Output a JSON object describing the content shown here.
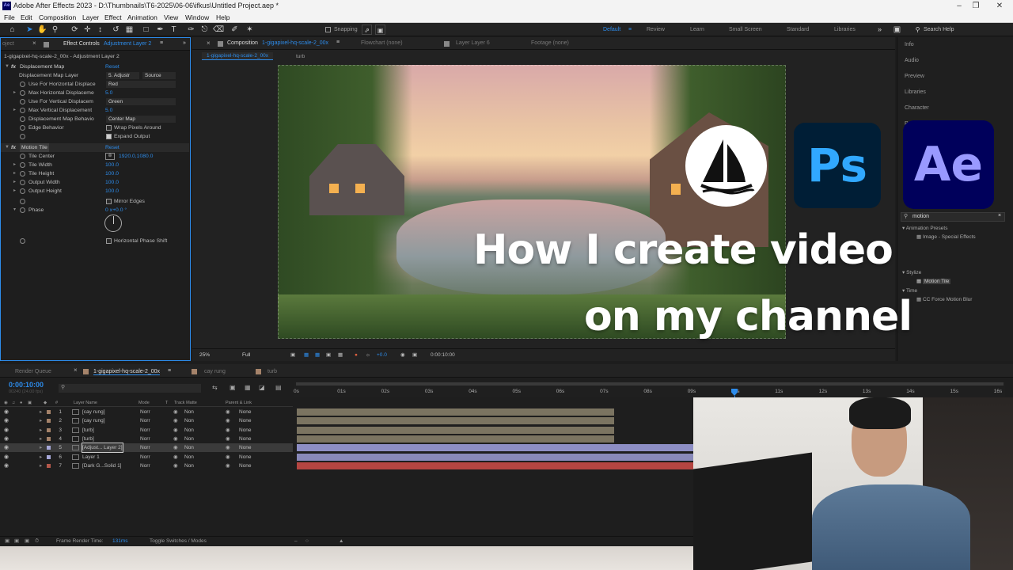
{
  "window": {
    "title": "Adobe After Effects 2023 - D:\\Thumbnails\\T6-2025\\06-06\\ifkus\\Untitled Project.aep *",
    "logo": "Ae"
  },
  "menu": [
    "File",
    "Edit",
    "Composition",
    "Layer",
    "Effect",
    "Animation",
    "View",
    "Window",
    "Help"
  ],
  "toolbar": {
    "snapping": "Snapping",
    "workspaces": [
      "Default",
      "Review",
      "Learn",
      "Small Screen",
      "Standard",
      "Libraries"
    ],
    "active_workspace": "Default",
    "search": "Search Help"
  },
  "effect_controls": {
    "tab_project": "oject",
    "tab": "Effect Controls",
    "tab_layer": "Adjustment Layer 2",
    "breadcrumb": "1-gigapixel-hq-scale-2_00x - Adjustment Layer 2",
    "displacement": {
      "name": "Displacement Map",
      "reset": "Reset",
      "rows": [
        {
          "label": "Displacement Map Layer",
          "value": "5. Adjustr",
          "value2": "Source"
        },
        {
          "label": "Use For Horizontal Displace",
          "value": "Red"
        },
        {
          "label": "Max Horizontal Displaceme",
          "value": "5.0"
        },
        {
          "label": "Use For Vertical Displacem",
          "value": "Green"
        },
        {
          "label": "Max Vertical Displacement",
          "value": "5.0"
        },
        {
          "label": "Displacement Map Behavio",
          "value": "Center Map"
        },
        {
          "label": "Edge Behavior",
          "value": "Wrap Pixels Around"
        },
        {
          "label": "",
          "value": "Expand Output"
        }
      ]
    },
    "motion_tile": {
      "name": "Motion Tile",
      "reset": "Reset",
      "rows": [
        {
          "label": "Tile Center",
          "value": "1920.0,1080.0"
        },
        {
          "label": "Tile Width",
          "value": "100.0"
        },
        {
          "label": "Tile Height",
          "value": "100.0"
        },
        {
          "label": "Output Width",
          "value": "100.0"
        },
        {
          "label": "Output Height",
          "value": "100.0"
        },
        {
          "label": "",
          "value": "Mirror Edges"
        },
        {
          "label": "Phase",
          "value": "0 x+0.0 °"
        },
        {
          "label": "",
          "value": "Horizontal Phase Shift"
        }
      ]
    }
  },
  "composition": {
    "tab": "Composition",
    "tab_name": "1-gigapixel-hq-scale-2_00x",
    "flowchart": "Flowchart (none)",
    "layer": "Layer Layer 6",
    "footage": "Footage (none)",
    "sub_tabs": [
      "1-gigapixel-hq-scale-2_00x",
      "turb"
    ],
    "zoom": "25%",
    "quality": "Full",
    "exposure": "+0.0",
    "timecode": "0:00:10:00"
  },
  "right_panel": {
    "items": [
      "Info",
      "Audio",
      "Preview",
      "Libraries",
      "Character",
      "Pa"
    ],
    "search_value": "motion",
    "tree": [
      {
        "label": "Animation Presets",
        "level": 0
      },
      {
        "label": "Image - Special Effects",
        "level": 1
      },
      {
        "label": "Stylize",
        "level": 0
      },
      {
        "label": "Motion Tile",
        "level": 1,
        "selected": true
      },
      {
        "label": "Time",
        "level": 0
      },
      {
        "label": "CC Force Motion Blur",
        "level": 1
      }
    ]
  },
  "timeline": {
    "tabs": [
      "Render Queue",
      "1-gigapixel-hq-scale-2_00x",
      "cay rung",
      "turb"
    ],
    "active_tab": "1-gigapixel-hq-scale-2_00x",
    "timecode": "0:00:10:00",
    "timecode_sub": "00240 (24.00 fps)",
    "columns": [
      "Layer Name",
      "Mode",
      "T",
      "Track Matte",
      "Parent & Link"
    ],
    "layers": [
      {
        "num": "1",
        "name": "[cay rung]",
        "mode": "Norr",
        "matte": "Non",
        "parent": "None",
        "label_color": "#a5836a",
        "bar_color": "#7b7461",
        "bar_end": 0.8
      },
      {
        "num": "2",
        "name": "[cay rung]",
        "mode": "Norr",
        "matte": "Non",
        "parent": "None",
        "label_color": "#a5836a",
        "bar_color": "#7b7461",
        "bar_end": 0.8
      },
      {
        "num": "3",
        "name": "[turb]",
        "mode": "Norr",
        "matte": "Non",
        "parent": "None",
        "label_color": "#a5836a",
        "bar_color": "#7b7461",
        "bar_end": 0.8
      },
      {
        "num": "4",
        "name": "[turb]",
        "mode": "Norr",
        "matte": "Non",
        "parent": "None",
        "label_color": "#a5836a",
        "bar_color": "#7b7461",
        "bar_end": 0.8
      },
      {
        "num": "5",
        "name": "[Adjust... Layer 2]",
        "mode": "Norr",
        "matte": "Non",
        "parent": "None",
        "label_color": "#a7a8d8",
        "bar_color": "#8d8ec4",
        "bar_end": 1.0,
        "selected": true
      },
      {
        "num": "6",
        "name": "Layer 1",
        "mode": "Norr",
        "matte": "Non",
        "parent": "None",
        "label_color": "#a7a8d8",
        "bar_color": "#8889b9",
        "bar_end": 1.0
      },
      {
        "num": "7",
        "name": "[Dark G...Solid 1]",
        "mode": "Norr",
        "matte": "Non",
        "parent": "None",
        "label_color": "#b4584b",
        "bar_color": "#b44541",
        "bar_end": 1.0
      }
    ],
    "ruler": [
      "0s",
      "01s",
      "02s",
      "03s",
      "04s",
      "05s",
      "06s",
      "07s",
      "08s",
      "09s",
      "10s",
      "11s",
      "12s",
      "13s",
      "14s",
      "15s",
      "16s"
    ],
    "playhead_seconds": 10,
    "frame_render_time_label": "Frame Render Time:",
    "frame_render_time": "131ms",
    "toggle": "Toggle Switches / Modes"
  },
  "thumbnail": {
    "headline_line1": "How I create video",
    "headline_line2": "on my channel",
    "logos": [
      {
        "name": "midjourney",
        "text": ""
      },
      {
        "name": "photoshop",
        "text": "Ps",
        "bg": "#001e36",
        "fg": "#31a8ff"
      },
      {
        "name": "after-effects",
        "text": "Ae",
        "bg": "#00005b",
        "fg": "#9999ff"
      }
    ]
  }
}
